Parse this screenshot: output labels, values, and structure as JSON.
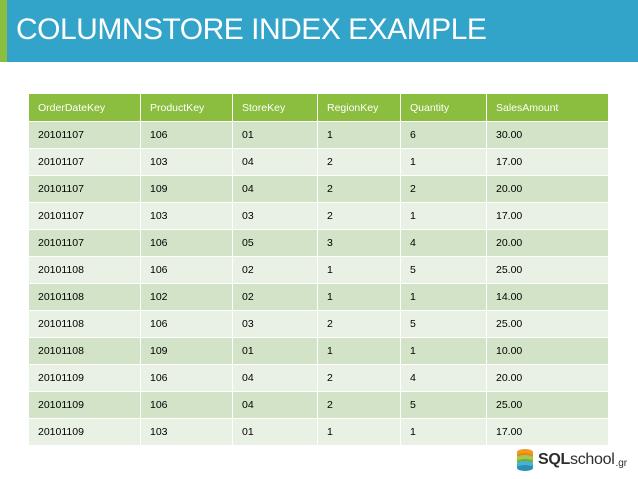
{
  "slide": {
    "title": "COLUMNSTORE INDEX EXAMPLE",
    "colors": {
      "title_bar": "#32a3c9",
      "accent": "#8bbd3f",
      "row_odd": "#d2e3c7",
      "row_even": "#e9f1e4"
    }
  },
  "table": {
    "columns": [
      "OrderDateKey",
      "ProductKey",
      "StoreKey",
      "RegionKey",
      "Quantity",
      "SalesAmount"
    ],
    "rows": [
      [
        "20101107",
        "106",
        "01",
        "1",
        "6",
        "30.00"
      ],
      [
        "20101107",
        "103",
        "04",
        "2",
        "1",
        "17.00"
      ],
      [
        "20101107",
        "109",
        "04",
        "2",
        "2",
        "20.00"
      ],
      [
        "20101107",
        "103",
        "03",
        "2",
        "1",
        "17.00"
      ],
      [
        "20101107",
        "106",
        "05",
        "3",
        "4",
        "20.00"
      ],
      [
        "20101108",
        "106",
        "02",
        "1",
        "5",
        "25.00"
      ],
      [
        "20101108",
        "102",
        "02",
        "1",
        "1",
        "14.00"
      ],
      [
        "20101108",
        "106",
        "03",
        "2",
        "5",
        "25.00"
      ],
      [
        "20101108",
        "109",
        "01",
        "1",
        "1",
        "10.00"
      ],
      [
        "20101109",
        "106",
        "04",
        "2",
        "4",
        "20.00"
      ],
      [
        "20101109",
        "106",
        "04",
        "2",
        "5",
        "25.00"
      ],
      [
        "20101109",
        "103",
        "01",
        "1",
        "1",
        "17.00"
      ]
    ]
  },
  "logo": {
    "icon": "database-stack-icon",
    "sql": "SQL",
    "school": "school",
    "gr": ".gr"
  }
}
